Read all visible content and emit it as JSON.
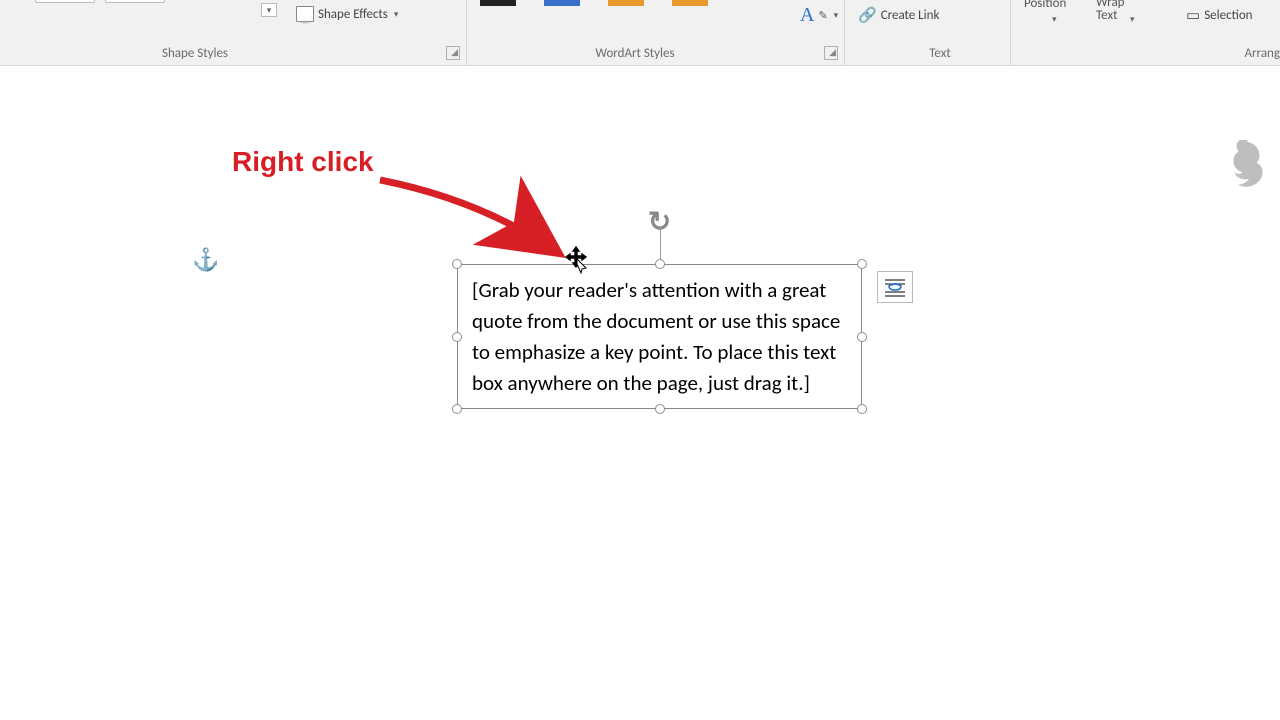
{
  "ribbon": {
    "shape_effects_label": "Shape Effects",
    "text_effects_letter": "A",
    "create_link_label": "Create Link",
    "position_label": "Position",
    "wrap_text_label": "Wrap Text",
    "selection_label": "Selection",
    "groups": {
      "shape_styles": "Shape Styles",
      "wordart_styles": "WordArt Styles",
      "text": "Text",
      "arrange": "Arrang"
    }
  },
  "textbox": {
    "content": "[Grab your reader's attention with a great quote from the document or use this space to emphasize a key point. To place this text box anywhere on the page, just drag it.]"
  },
  "annotation": {
    "label": "Right click"
  }
}
